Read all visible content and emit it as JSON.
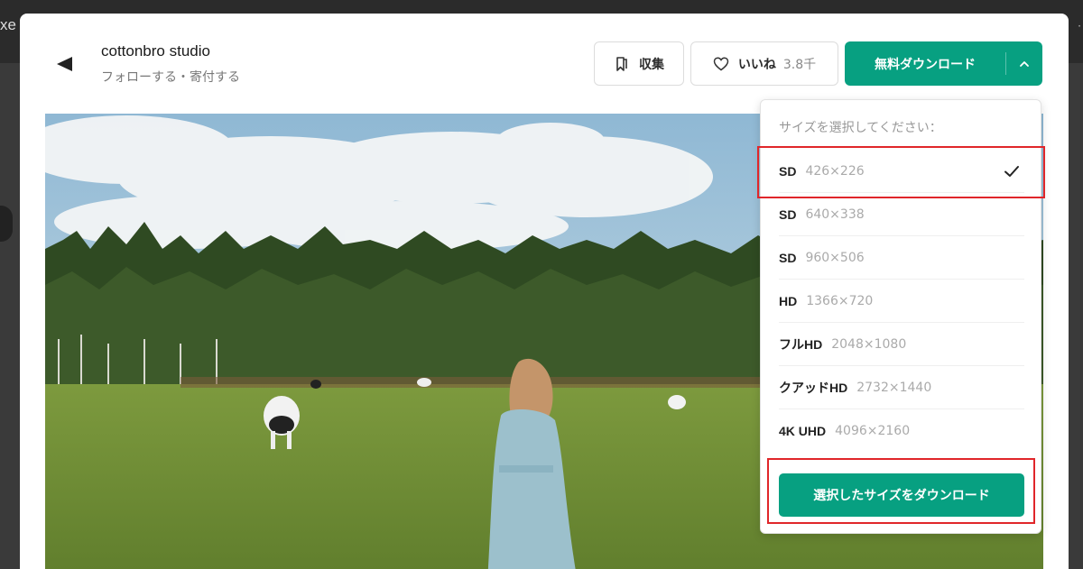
{
  "background": {
    "logo_fragment": "xe",
    "right_fragment": "·"
  },
  "author": {
    "name": "cottonbro studio",
    "follow": "フォローする",
    "separator": "・",
    "donate": "寄付する"
  },
  "toolbar": {
    "collect_label": "収集",
    "like_label": "いいね",
    "like_count": "3.8千",
    "download_label": "無料ダウンロード"
  },
  "dropdown": {
    "header": "サイズを選択してください：",
    "items": [
      {
        "quality": "SD",
        "dims": "426×226",
        "selected": true
      },
      {
        "quality": "SD",
        "dims": "640×338",
        "selected": false
      },
      {
        "quality": "SD",
        "dims": "960×506",
        "selected": false
      },
      {
        "quality": "HD",
        "dims": "1366×720",
        "selected": false
      },
      {
        "quality": "フルHD",
        "dims": "2048×1080",
        "selected": false
      },
      {
        "quality": "クアッドHD",
        "dims": "2732×1440",
        "selected": false
      },
      {
        "quality": "4K UHD",
        "dims": "4096×2160",
        "selected": false
      }
    ],
    "download_selected_label": "選択したサイズをダウンロード"
  },
  "colors": {
    "accent": "#07a081",
    "highlight": "#e0262a"
  },
  "icons": {
    "back": "back-arrow-icon",
    "collect": "bookmark-icon",
    "like": "heart-icon",
    "caret": "chevron-up-icon",
    "check": "checkmark-icon"
  }
}
